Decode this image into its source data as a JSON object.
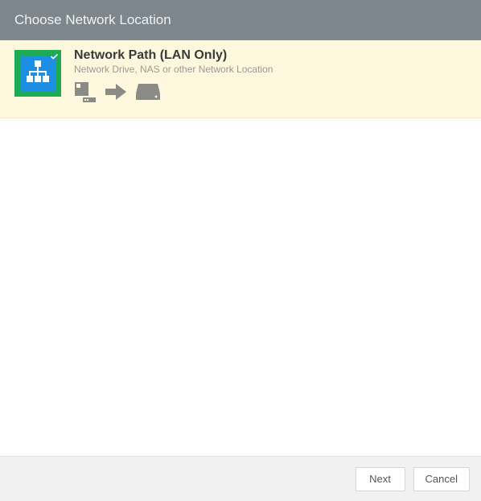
{
  "titlebar": {
    "title": "Choose Network Location"
  },
  "option": {
    "title": "Network Path (LAN Only)",
    "subtitle": "Network Drive, NAS or other Network Location",
    "selected": true,
    "icon_name": "network-tree-icon",
    "glyph_icons": [
      "server-icon",
      "arrow-right-icon",
      "drive-icon"
    ]
  },
  "footer": {
    "next_label": "Next",
    "cancel_label": "Cancel"
  },
  "colors": {
    "titlebar_bg": "#7d868c",
    "option_bg": "#fdf7de",
    "select_green": "#1dab53",
    "icon_blue": "#1c8fe3",
    "glyph_grey": "#8a8a86"
  }
}
